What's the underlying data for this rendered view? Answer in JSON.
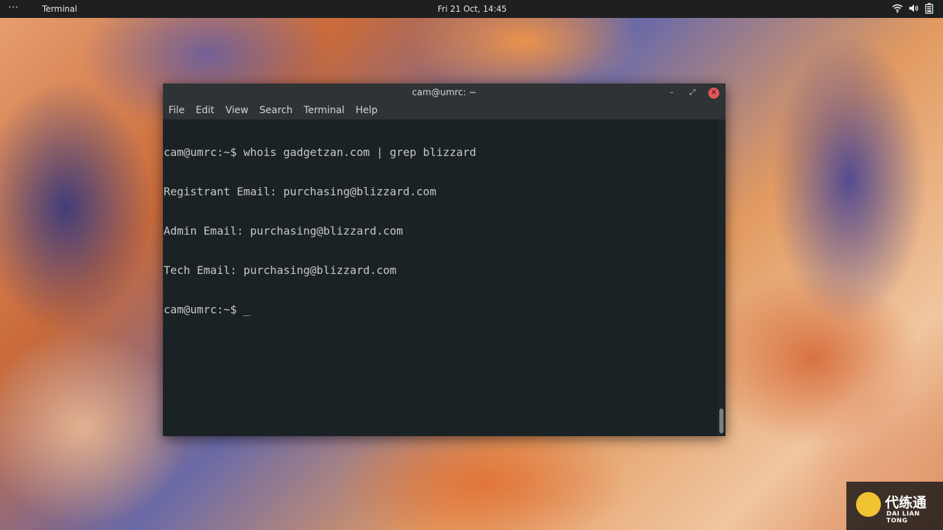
{
  "topbar": {
    "activities_label": "···",
    "app_menu_label": "Terminal",
    "clock": "Fri 21 Oct, 14:45",
    "tray_icons": [
      "wifi-icon",
      "volume-icon",
      "battery-icon"
    ]
  },
  "window": {
    "title": "cam@umrc: ~",
    "controls": {
      "minimize": "–",
      "maximize": "⤢",
      "close": "✕"
    },
    "menu": [
      "File",
      "Edit",
      "View",
      "Search",
      "Terminal",
      "Help"
    ],
    "lines": [
      "cam@umrc:~$ whois gadgetzan.com | grep blizzard",
      "Registrant Email: purchasing@blizzard.com",
      "Admin Email: purchasing@blizzard.com",
      "Tech Email: purchasing@blizzard.com",
      "cam@umrc:~$ _"
    ],
    "colors": {
      "background": "#1b2226",
      "foreground": "#c7c7c7",
      "titlebar": "#2f3336",
      "close_button": "#e05555"
    }
  },
  "watermark": {
    "title": "代练通",
    "subtitle": "DAI LIAN TONG"
  }
}
